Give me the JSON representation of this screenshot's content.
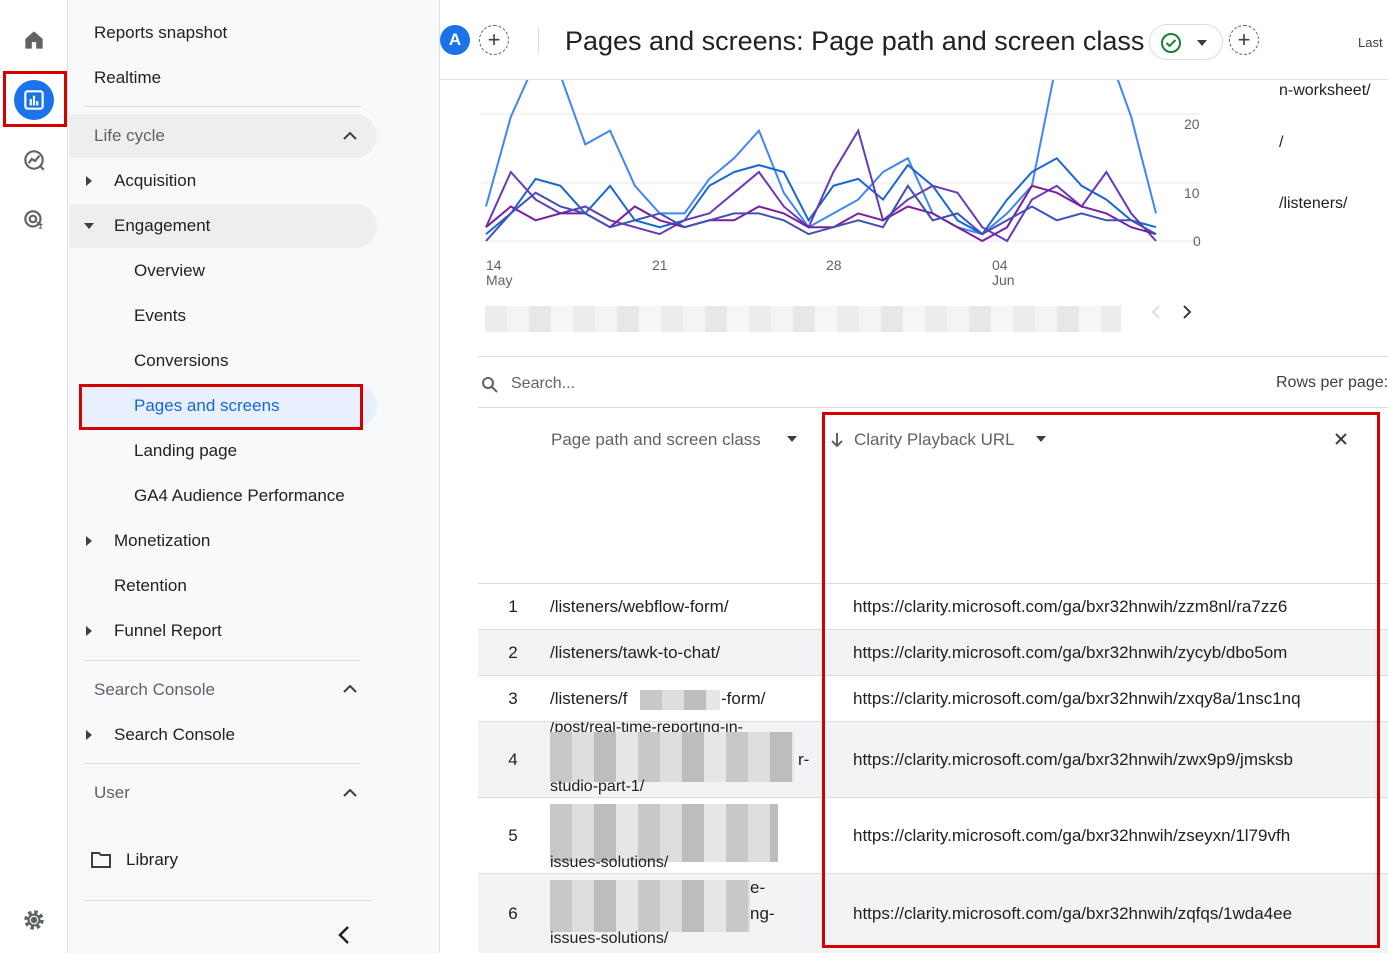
{
  "nav": {
    "reports_snapshot": "Reports snapshot",
    "realtime": "Realtime",
    "life_cycle": "Life cycle",
    "acquisition": "Acquisition",
    "engagement": "Engagement",
    "overview": "Overview",
    "events": "Events",
    "conversions": "Conversions",
    "pages_and_screens": "Pages and screens",
    "landing_page": "Landing page",
    "ga4_audience": "GA4 Audience Performance",
    "monetization": "Monetization",
    "retention": "Retention",
    "funnel_report": "Funnel Report",
    "search_console_section": "Search Console",
    "search_console_item": "Search Console",
    "user_section": "User",
    "library": "Library"
  },
  "header": {
    "avatar_letter": "A",
    "title": "Pages and screens: Page path and screen class",
    "date_label": "Last"
  },
  "chart_data": {
    "type": "line",
    "x_ticks": [
      {
        "day": "14",
        "month": "May"
      },
      {
        "day": "21",
        "month": ""
      },
      {
        "day": "28",
        "month": ""
      },
      {
        "day": "04",
        "month": "Jun"
      }
    ],
    "y_ticks": [
      "20",
      "10",
      "0"
    ],
    "series_colors": [
      "#4285f4",
      "#1967d2",
      "#673ab7",
      "#7b1fa2",
      "#3f51b5"
    ],
    "grid": true,
    "legend_items": [
      "n-worksheet/",
      "/",
      "/listeners/"
    ]
  },
  "table": {
    "search_placeholder": "Search...",
    "rows_per_page_label": "Rows per page:",
    "col_path": "Page path and screen class",
    "col_url": "Clarity Playback URL",
    "rows": [
      {
        "num": "1",
        "path": "/listeners/webflow-form/",
        "url": "https://clarity.microsoft.com/ga/bxr32hnwih/zzm8nl/ra7zz6"
      },
      {
        "num": "2",
        "path": "/listeners/tawk-to-chat/",
        "url": "https://clarity.microsoft.com/ga/bxr32hnwih/zycyb/dbo5om"
      },
      {
        "num": "3",
        "path_start": "/listeners/f",
        "path_end": "-form/",
        "url": "https://clarity.microsoft.com/ga/bxr32hnwih/zxqy8a/1nsc1nq"
      },
      {
        "num": "4",
        "path_top": "/post/real-time-reporting-in-",
        "path_mid_suffix": "r-",
        "path_bottom": "studio-part-1/",
        "url": "https://clarity.microsoft.com/ga/bxr32hnwih/zwx9p9/jmsksb"
      },
      {
        "num": "5",
        "path_bottom": "issues-solutions/",
        "url": "https://clarity.microsoft.com/ga/bxr32hnwih/zseyxn/1l79vfh"
      },
      {
        "num": "6",
        "path_suffix_1": "e-",
        "path_suffix_2": "ng-",
        "path_bottom": "issues-solutions/",
        "url": "https://clarity.microsoft.com/ga/bxr32hnwih/zqfqs/1wda4ee"
      }
    ]
  }
}
